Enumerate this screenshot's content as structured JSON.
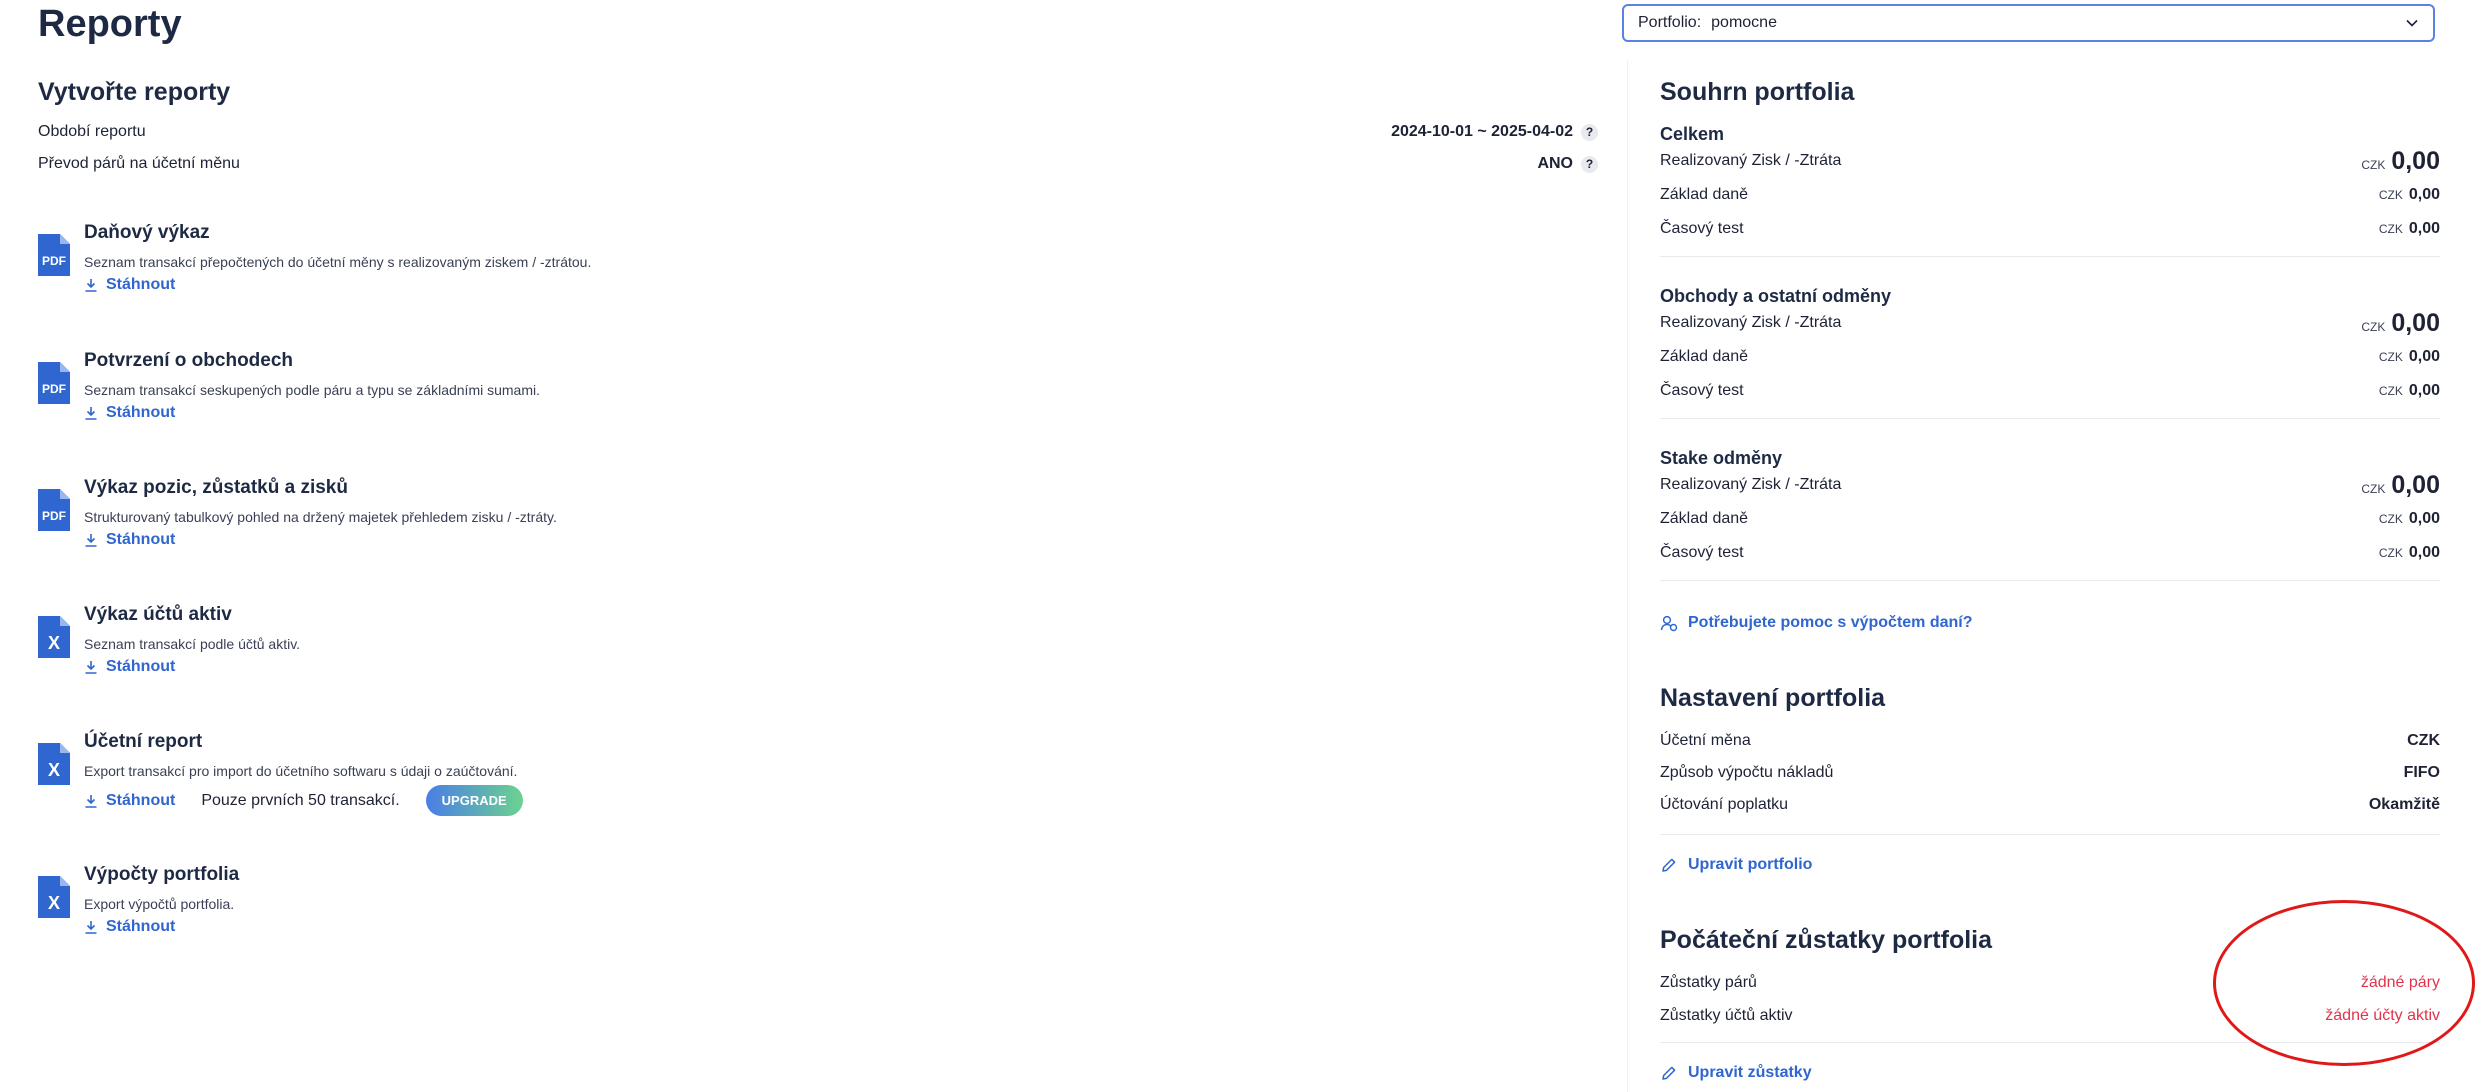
{
  "page": {
    "title": "Reporty"
  },
  "portfolio_select": {
    "label": "Portfolio:",
    "value": "pomocne"
  },
  "create": {
    "title": "Vytvořte reporty",
    "period_label": "Období reportu",
    "period_value": "2024-10-01 ~ 2025-04-02",
    "convert_label": "Převod párů na účetní měnu",
    "convert_value": "ANO",
    "help_glyph": "?"
  },
  "reports": [
    {
      "type": "pdf",
      "name": "Daňový výkaz",
      "desc": "Seznam transakcí přepočtených do účetní měny s realizovaným ziskem / -ztrátou.",
      "download": "Stáhnout"
    },
    {
      "type": "pdf",
      "name": "Potvrzení o obchodech",
      "desc": "Seznam transakcí seskupených podle páru a typu se základními sumami.",
      "download": "Stáhnout"
    },
    {
      "type": "pdf",
      "name": "Výkaz pozic, zůstatků a zisků",
      "desc": "Strukturovaný tabulkový pohled na držený majetek přehledem zisku / -ztráty.",
      "download": "Stáhnout"
    },
    {
      "type": "xls",
      "name": "Výkaz účtů aktiv",
      "desc": "Seznam transakcí podle účtů aktiv.",
      "download": "Stáhnout"
    },
    {
      "type": "xls",
      "name": "Účetní report",
      "desc": "Export transakcí pro import do účetního softwaru s údaji o zaúčtování.",
      "download": "Stáhnout",
      "limit": "Pouze prvních 50 transakcí.",
      "upgrade": "UPGRADE"
    },
    {
      "type": "xls",
      "name": "Výpočty portfolia",
      "desc": "Export výpočtů portfolia.",
      "download": "Stáhnout"
    }
  ],
  "icons": {
    "pdf_text": "PDF",
    "xls_text": "X"
  },
  "summary": {
    "title": "Souhrn portfolia",
    "groups": [
      {
        "title": "Celkem",
        "rows": [
          {
            "label": "Realizovaný Zisk / -Ztráta",
            "currency": "CZK",
            "amount": "0,00"
          },
          {
            "label": "Základ daně",
            "currency": "CZK",
            "amount": "0,00"
          },
          {
            "label": "Časový test",
            "currency": "CZK",
            "amount": "0,00"
          }
        ]
      },
      {
        "title": "Obchody a ostatní odměny",
        "rows": [
          {
            "label": "Realizovaný Zisk / -Ztráta",
            "currency": "CZK",
            "amount": "0,00"
          },
          {
            "label": "Základ daně",
            "currency": "CZK",
            "amount": "0,00"
          },
          {
            "label": "Časový test",
            "currency": "CZK",
            "amount": "0,00"
          }
        ]
      },
      {
        "title": "Stake odměny",
        "rows": [
          {
            "label": "Realizovaný Zisk / -Ztráta",
            "currency": "CZK",
            "amount": "0,00"
          },
          {
            "label": "Základ daně",
            "currency": "CZK",
            "amount": "0,00"
          },
          {
            "label": "Časový test",
            "currency": "CZK",
            "amount": "0,00"
          }
        ]
      }
    ],
    "help_link": "Potřebujete pomoc s výpočtem daní?"
  },
  "settings": {
    "title": "Nastavení portfolia",
    "rows": [
      {
        "label": "Účetní měna",
        "value": "CZK"
      },
      {
        "label": "Způsob výpočtu nákladů",
        "value": "FIFO"
      },
      {
        "label": "Účtování poplatku",
        "value": "Okamžitě"
      }
    ],
    "edit_link": "Upravit portfolio"
  },
  "balances": {
    "title": "Počáteční zůstatky portfolia",
    "rows": [
      {
        "label": "Zůstatky párů",
        "value": "žádné páry"
      },
      {
        "label": "Zůstatky účtů aktiv",
        "value": "žádné účty aktiv"
      }
    ],
    "edit_link": "Upravit zůstatky"
  },
  "colors": {
    "accent": "#2f66d0",
    "danger": "#e0344b",
    "annotation": "#e01818",
    "icon_blue": "#2f66d0"
  }
}
